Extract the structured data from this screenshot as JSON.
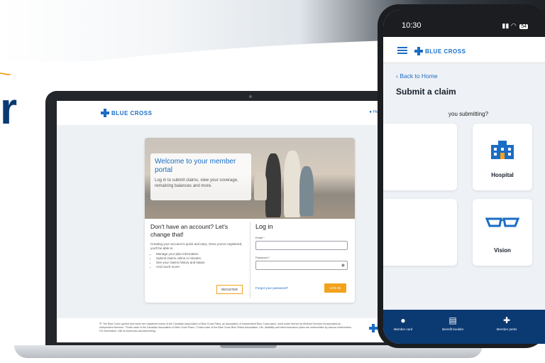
{
  "hero_headline": "r",
  "laptop": {
    "header": {
      "logo_text": "BLUE CROSS",
      "help_label": "Help"
    },
    "welcome": {
      "title": "Welcome to your member portal",
      "body": "Log in to submit claims, view your coverage, remaining balances and more."
    },
    "signup": {
      "title": "Don't have an account? Let's change that!",
      "intro": "Creating your account is quick and easy. Once you've registered, you'll be able to:",
      "bullets": [
        "Manage your plan information",
        "Submit claims online in minutes",
        "See your claims history and status",
        "And much more!"
      ],
      "register_label": "REGISTER"
    },
    "login": {
      "title": "Log in",
      "email_label": "Email *",
      "email_value": "",
      "password_label": "Password *",
      "password_value": "",
      "forgot_label": "Forgot your password?",
      "submit_label": "LOG IN"
    },
    "footer": {
      "text": "®* The Blue Cross symbol and name are registered marks of the Canadian Association of Blue Cross Plans, an association of independent Blue Cross plans, used under licence by Medical Services Incorporated an independent licensee. *Trade-mark of the Canadian Association of Blue Cross Plans. †Trade-mark of the Blue Cross Blue Shield Association. Life, disability and travel insurance plans are underwritten by various underwriters. For information, visit sk.bluecross.ca/underwriting."
    }
  },
  "phone": {
    "status": {
      "time": "10:30",
      "battery": "54"
    },
    "logo_text": "BLUE CROSS",
    "back_label": "Back to Home",
    "page_title": "Submit a claim",
    "question": "you submitting?",
    "tiles": [
      {
        "label": "Hospital",
        "icon": "hospital-icon"
      },
      {
        "label": "Vision",
        "icon": "glasses-icon"
      }
    ],
    "tabbar": [
      {
        "label": "Member card",
        "icon": "person-icon"
      },
      {
        "label": "Benefit booklet",
        "icon": "document-icon"
      },
      {
        "label": "Member perks",
        "icon": "gift-icon"
      }
    ]
  },
  "colors": {
    "brand_blue": "#1a6dc5",
    "navy": "#0b3a73",
    "accent_orange": "#f3a21c"
  }
}
